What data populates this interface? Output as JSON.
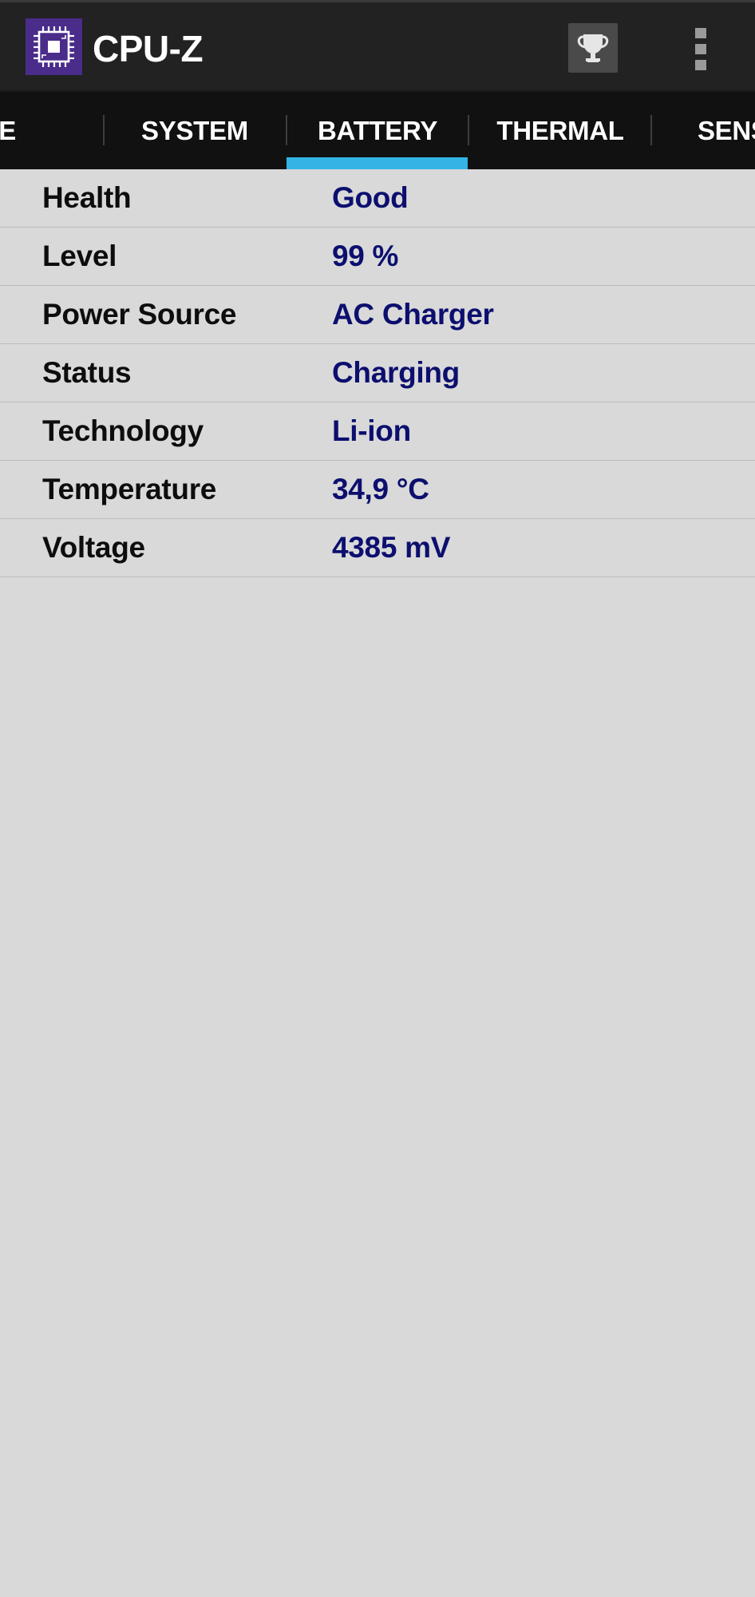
{
  "app": {
    "title": "CPU-Z"
  },
  "toolbar": {
    "trophy_icon": "trophy-icon",
    "overflow_icon": "more-vertical-icon"
  },
  "tabs": [
    {
      "label": "VICE"
    },
    {
      "label": "SYSTEM"
    },
    {
      "label": "BATTERY",
      "active": true
    },
    {
      "label": "THERMAL"
    },
    {
      "label": "SENSO"
    }
  ],
  "battery": {
    "rows": [
      {
        "label": "Health",
        "value": "Good"
      },
      {
        "label": "Level",
        "value": "99 %"
      },
      {
        "label": "Power Source",
        "value": "AC Charger"
      },
      {
        "label": "Status",
        "value": "Charging"
      },
      {
        "label": "Technology",
        "value": "Li-ion"
      },
      {
        "label": "Temperature",
        "value": "34,9 °C"
      },
      {
        "label": "Voltage",
        "value": "4385 mV"
      }
    ]
  },
  "colors": {
    "appbar": "#222222",
    "tabbar": "#111111",
    "accent": "#33b4e5",
    "background": "#d9d9d9",
    "value_text": "#0c0f6e",
    "logo_bg": "#4a2c8a"
  }
}
